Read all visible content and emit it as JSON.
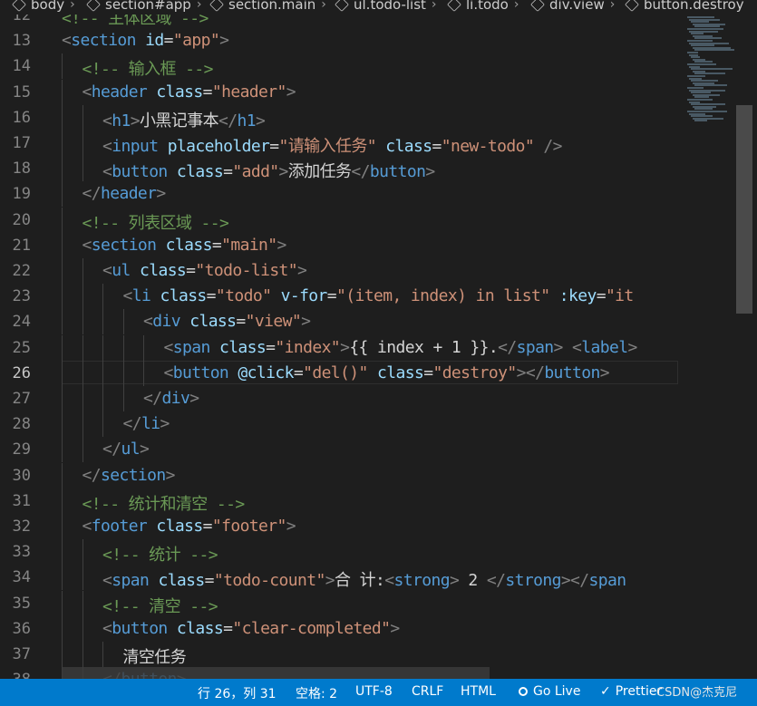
{
  "breadcrumb": [
    {
      "label": "body"
    },
    {
      "label": "section#app"
    },
    {
      "label": "section.main"
    },
    {
      "label": "ul.todo-list"
    },
    {
      "label": "li.todo"
    },
    {
      "label": "div.view"
    },
    {
      "label": "button.destroy"
    }
  ],
  "editor": {
    "active_line": 26,
    "lines": [
      {
        "num": "12",
        "indent": 0,
        "tokens": [
          {
            "t": "cmt",
            "v": "<!-- 主体区域 -->"
          }
        ]
      },
      {
        "num": "13",
        "indent": 0,
        "tokens": [
          {
            "t": "punct",
            "v": "<"
          },
          {
            "t": "tag",
            "v": "section"
          },
          {
            "t": "text",
            "v": " "
          },
          {
            "t": "attr",
            "v": "id"
          },
          {
            "t": "text",
            "v": "="
          },
          {
            "t": "val",
            "v": "\"app\""
          },
          {
            "t": "punct",
            "v": ">"
          }
        ]
      },
      {
        "num": "14",
        "indent": 1,
        "tokens": [
          {
            "t": "cmt",
            "v": "<!-- 输入框 -->"
          }
        ]
      },
      {
        "num": "15",
        "indent": 1,
        "tokens": [
          {
            "t": "punct",
            "v": "<"
          },
          {
            "t": "tag",
            "v": "header"
          },
          {
            "t": "text",
            "v": " "
          },
          {
            "t": "attr",
            "v": "class"
          },
          {
            "t": "text",
            "v": "="
          },
          {
            "t": "val",
            "v": "\"header\""
          },
          {
            "t": "punct",
            "v": ">"
          }
        ]
      },
      {
        "num": "16",
        "indent": 2,
        "tokens": [
          {
            "t": "punct",
            "v": "<"
          },
          {
            "t": "tag",
            "v": "h1"
          },
          {
            "t": "punct",
            "v": ">"
          },
          {
            "t": "text",
            "v": "小黑记事本"
          },
          {
            "t": "punct",
            "v": "</"
          },
          {
            "t": "tag",
            "v": "h1"
          },
          {
            "t": "punct",
            "v": ">"
          }
        ]
      },
      {
        "num": "17",
        "indent": 2,
        "tokens": [
          {
            "t": "punct",
            "v": "<"
          },
          {
            "t": "tag",
            "v": "input"
          },
          {
            "t": "text",
            "v": " "
          },
          {
            "t": "attr",
            "v": "placeholder"
          },
          {
            "t": "text",
            "v": "="
          },
          {
            "t": "val",
            "v": "\"请输入任务\""
          },
          {
            "t": "text",
            "v": " "
          },
          {
            "t": "attr",
            "v": "class"
          },
          {
            "t": "text",
            "v": "="
          },
          {
            "t": "val",
            "v": "\"new-todo\""
          },
          {
            "t": "text",
            "v": " "
          },
          {
            "t": "punct",
            "v": "/>"
          }
        ]
      },
      {
        "num": "18",
        "indent": 2,
        "tokens": [
          {
            "t": "punct",
            "v": "<"
          },
          {
            "t": "tag",
            "v": "button"
          },
          {
            "t": "text",
            "v": " "
          },
          {
            "t": "attr",
            "v": "class"
          },
          {
            "t": "text",
            "v": "="
          },
          {
            "t": "val",
            "v": "\"add\""
          },
          {
            "t": "punct",
            "v": ">"
          },
          {
            "t": "text",
            "v": "添加任务"
          },
          {
            "t": "punct",
            "v": "</"
          },
          {
            "t": "tag",
            "v": "button"
          },
          {
            "t": "punct",
            "v": ">"
          }
        ]
      },
      {
        "num": "19",
        "indent": 1,
        "tokens": [
          {
            "t": "punct",
            "v": "</"
          },
          {
            "t": "tag",
            "v": "header"
          },
          {
            "t": "punct",
            "v": ">"
          }
        ]
      },
      {
        "num": "20",
        "indent": 1,
        "tokens": [
          {
            "t": "cmt",
            "v": "<!-- 列表区域 -->"
          }
        ]
      },
      {
        "num": "21",
        "indent": 1,
        "tokens": [
          {
            "t": "punct",
            "v": "<"
          },
          {
            "t": "tag",
            "v": "section"
          },
          {
            "t": "text",
            "v": " "
          },
          {
            "t": "attr",
            "v": "class"
          },
          {
            "t": "text",
            "v": "="
          },
          {
            "t": "val",
            "v": "\"main\""
          },
          {
            "t": "punct",
            "v": ">"
          }
        ]
      },
      {
        "num": "22",
        "indent": 2,
        "tokens": [
          {
            "t": "punct",
            "v": "<"
          },
          {
            "t": "tag",
            "v": "ul"
          },
          {
            "t": "text",
            "v": " "
          },
          {
            "t": "attr",
            "v": "class"
          },
          {
            "t": "text",
            "v": "="
          },
          {
            "t": "val",
            "v": "\"todo-list\""
          },
          {
            "t": "punct",
            "v": ">"
          }
        ]
      },
      {
        "num": "23",
        "indent": 3,
        "tokens": [
          {
            "t": "punct",
            "v": "<"
          },
          {
            "t": "tag",
            "v": "li"
          },
          {
            "t": "text",
            "v": " "
          },
          {
            "t": "attr",
            "v": "class"
          },
          {
            "t": "text",
            "v": "="
          },
          {
            "t": "val",
            "v": "\"todo\""
          },
          {
            "t": "text",
            "v": " "
          },
          {
            "t": "attr",
            "v": "v-for"
          },
          {
            "t": "text",
            "v": "="
          },
          {
            "t": "val",
            "v": "\"(item, index) in list\""
          },
          {
            "t": "text",
            "v": " "
          },
          {
            "t": "attr",
            "v": ":key"
          },
          {
            "t": "text",
            "v": "="
          },
          {
            "t": "val",
            "v": "\"it"
          }
        ]
      },
      {
        "num": "24",
        "indent": 4,
        "tokens": [
          {
            "t": "punct",
            "v": "<"
          },
          {
            "t": "tag",
            "v": "div"
          },
          {
            "t": "text",
            "v": " "
          },
          {
            "t": "attr",
            "v": "class"
          },
          {
            "t": "text",
            "v": "="
          },
          {
            "t": "val",
            "v": "\"view\""
          },
          {
            "t": "punct",
            "v": ">"
          }
        ]
      },
      {
        "num": "25",
        "indent": 5,
        "tokens": [
          {
            "t": "punct",
            "v": "<"
          },
          {
            "t": "tag",
            "v": "span"
          },
          {
            "t": "text",
            "v": " "
          },
          {
            "t": "attr",
            "v": "class"
          },
          {
            "t": "text",
            "v": "="
          },
          {
            "t": "val",
            "v": "\"index\""
          },
          {
            "t": "punct",
            "v": ">"
          },
          {
            "t": "text",
            "v": "{{ index + 1 }}."
          },
          {
            "t": "punct",
            "v": "</"
          },
          {
            "t": "tag",
            "v": "span"
          },
          {
            "t": "punct",
            "v": ">"
          },
          {
            "t": "text",
            "v": " "
          },
          {
            "t": "punct",
            "v": "<"
          },
          {
            "t": "tag",
            "v": "label"
          },
          {
            "t": "punct",
            "v": ">"
          }
        ]
      },
      {
        "num": "26",
        "indent": 5,
        "tokens": [
          {
            "t": "punct",
            "v": "<"
          },
          {
            "t": "tag",
            "v": "button"
          },
          {
            "t": "text",
            "v": " "
          },
          {
            "t": "attr",
            "v": "@click"
          },
          {
            "t": "text",
            "v": "="
          },
          {
            "t": "val",
            "v": "\"del()\""
          },
          {
            "t": "text",
            "v": " "
          },
          {
            "t": "attr",
            "v": "class"
          },
          {
            "t": "text",
            "v": "="
          },
          {
            "t": "val",
            "v": "\"destroy\""
          },
          {
            "t": "punct",
            "v": "></"
          },
          {
            "t": "tag",
            "v": "button"
          },
          {
            "t": "punct",
            "v": ">"
          }
        ]
      },
      {
        "num": "27",
        "indent": 4,
        "tokens": [
          {
            "t": "punct",
            "v": "</"
          },
          {
            "t": "tag",
            "v": "div"
          },
          {
            "t": "punct",
            "v": ">"
          }
        ]
      },
      {
        "num": "28",
        "indent": 3,
        "tokens": [
          {
            "t": "punct",
            "v": "</"
          },
          {
            "t": "tag",
            "v": "li"
          },
          {
            "t": "punct",
            "v": ">"
          }
        ]
      },
      {
        "num": "29",
        "indent": 2,
        "tokens": [
          {
            "t": "punct",
            "v": "</"
          },
          {
            "t": "tag",
            "v": "ul"
          },
          {
            "t": "punct",
            "v": ">"
          }
        ]
      },
      {
        "num": "30",
        "indent": 1,
        "tokens": [
          {
            "t": "punct",
            "v": "</"
          },
          {
            "t": "tag",
            "v": "section"
          },
          {
            "t": "punct",
            "v": ">"
          }
        ]
      },
      {
        "num": "31",
        "indent": 1,
        "tokens": [
          {
            "t": "cmt",
            "v": "<!-- 统计和清空 -->"
          }
        ]
      },
      {
        "num": "32",
        "indent": 1,
        "tokens": [
          {
            "t": "punct",
            "v": "<"
          },
          {
            "t": "tag",
            "v": "footer"
          },
          {
            "t": "text",
            "v": " "
          },
          {
            "t": "attr",
            "v": "class"
          },
          {
            "t": "text",
            "v": "="
          },
          {
            "t": "val",
            "v": "\"footer\""
          },
          {
            "t": "punct",
            "v": ">"
          }
        ]
      },
      {
        "num": "33",
        "indent": 2,
        "tokens": [
          {
            "t": "cmt",
            "v": "<!-- 统计 -->"
          }
        ]
      },
      {
        "num": "34",
        "indent": 2,
        "tokens": [
          {
            "t": "punct",
            "v": "<"
          },
          {
            "t": "tag",
            "v": "span"
          },
          {
            "t": "text",
            "v": " "
          },
          {
            "t": "attr",
            "v": "class"
          },
          {
            "t": "text",
            "v": "="
          },
          {
            "t": "val",
            "v": "\"todo-count\""
          },
          {
            "t": "punct",
            "v": ">"
          },
          {
            "t": "text",
            "v": "合 计:"
          },
          {
            "t": "punct",
            "v": "<"
          },
          {
            "t": "tag",
            "v": "strong"
          },
          {
            "t": "punct",
            "v": ">"
          },
          {
            "t": "text",
            "v": " 2 "
          },
          {
            "t": "punct",
            "v": "</"
          },
          {
            "t": "tag",
            "v": "strong"
          },
          {
            "t": "punct",
            "v": "></"
          },
          {
            "t": "tag",
            "v": "span"
          }
        ]
      },
      {
        "num": "35",
        "indent": 2,
        "tokens": [
          {
            "t": "cmt",
            "v": "<!-- 清空 -->"
          }
        ]
      },
      {
        "num": "36",
        "indent": 2,
        "tokens": [
          {
            "t": "punct",
            "v": "<"
          },
          {
            "t": "tag",
            "v": "button"
          },
          {
            "t": "text",
            "v": " "
          },
          {
            "t": "attr",
            "v": "class"
          },
          {
            "t": "text",
            "v": "="
          },
          {
            "t": "val",
            "v": "\"clear-completed\""
          },
          {
            "t": "punct",
            "v": ">"
          }
        ]
      },
      {
        "num": "37",
        "indent": 3,
        "tokens": [
          {
            "t": "text",
            "v": "清空任务"
          }
        ]
      },
      {
        "num": "38",
        "indent": 2,
        "tokens": [
          {
            "t": "punct",
            "v": "</"
          },
          {
            "t": "tag",
            "v": "button"
          },
          {
            "t": "punct",
            "v": ">"
          }
        ]
      }
    ]
  },
  "status": {
    "position": "行 26，列 31",
    "spaces": "空格: 2",
    "encoding": "UTF-8",
    "eol": "CRLF",
    "language": "HTML",
    "golive": "Go Live",
    "prettier": "Prettier"
  },
  "watermark": "CSDN@杰克尼",
  "colors": {
    "status_bar": "#007acc",
    "tag": "#569cd6",
    "attr": "#9cdcfe",
    "string": "#ce9178",
    "comment": "#6a9955"
  }
}
